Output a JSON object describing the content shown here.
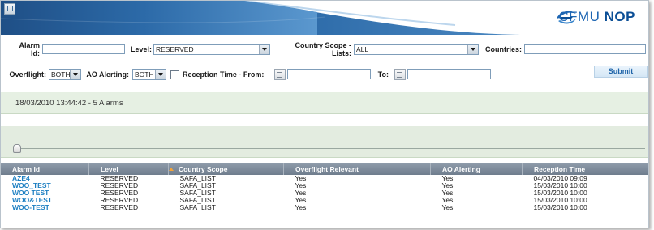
{
  "header": {
    "app_icon": "app-window-icon",
    "logo_text_light": "CFMU ",
    "logo_text_bold": "NOP",
    "brand_color": "#1e66b3"
  },
  "filters": {
    "alarm_id_label": "Alarm Id:",
    "alarm_id_value": "",
    "level_label": "Level:",
    "level_value": "RESERVED",
    "country_scope_label": "Country Scope - Lists:",
    "country_scope_value": "ALL",
    "countries_label": "Countries:",
    "countries_value": "",
    "overflight_label": "Overflight:",
    "overflight_value": "BOTH",
    "ao_alerting_label": "AO Alerting:",
    "ao_alerting_value": "BOTH",
    "reception_from_label": "Reception Time - From:",
    "reception_from_value": "",
    "reception_to_label": "To:",
    "reception_to_value": "",
    "submit_label": "Submit"
  },
  "status": {
    "text": "18/03/2010 13:44:42 - 5 Alarms"
  },
  "table": {
    "headers": [
      "Alarm Id",
      "Level",
      "Country Scope",
      "Overflight Relevant",
      "AO Alerting",
      "Reception Time"
    ],
    "sort_color": "#f2a33a",
    "rows": [
      [
        "AZE4",
        "RESERVED",
        "SAFA_LIST",
        "Yes",
        "Yes",
        "04/03/2010 09:09"
      ],
      [
        "WOO_TEST",
        "RESERVED",
        "SAFA_LIST",
        "Yes",
        "Yes",
        "15/03/2010 10:00"
      ],
      [
        "WOO TEST",
        "RESERVED",
        "SAFA_LIST",
        "Yes",
        "Yes",
        "15/03/2010 10:00"
      ],
      [
        "WOO&TEST",
        "RESERVED",
        "SAFA_LIST",
        "Yes",
        "Yes",
        "15/03/2010 10:00"
      ],
      [
        "WOO-TEST",
        "RESERVED",
        "SAFA_LIST",
        "Yes",
        "Yes",
        "15/03/2010 10:00"
      ]
    ]
  }
}
